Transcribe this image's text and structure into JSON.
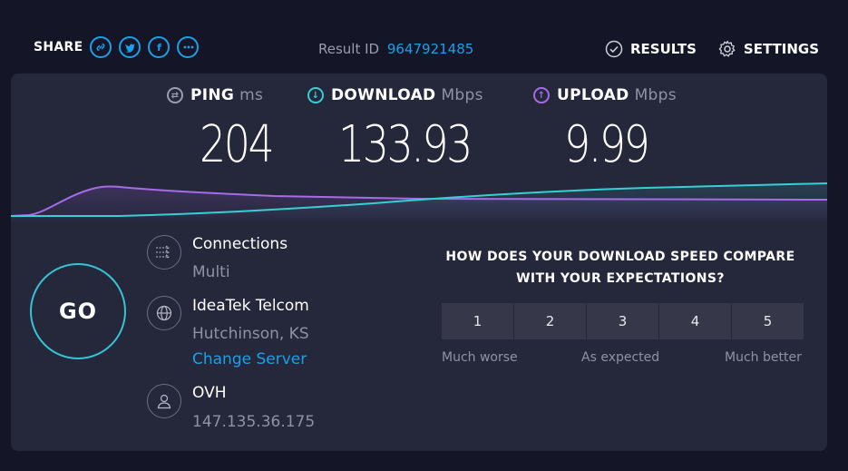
{
  "header": {
    "share_label": "SHARE",
    "share_buttons": [
      {
        "icon": "link-icon"
      },
      {
        "icon": "twitter-icon"
      },
      {
        "icon": "facebook-icon",
        "glyph": "f"
      },
      {
        "icon": "more-icon",
        "glyph": "•••"
      }
    ],
    "result_label": "Result ID",
    "result_id": "9647921485",
    "results_label": "RESULTS",
    "settings_label": "SETTINGS"
  },
  "metrics": {
    "ping": {
      "label": "PING",
      "unit": "ms",
      "value": "204"
    },
    "download": {
      "label": "DOWNLOAD",
      "unit": "Mbps",
      "value": "133.93"
    },
    "upload": {
      "label": "UPLOAD",
      "unit": "Mbps",
      "value": "9.99"
    }
  },
  "go_label": "GO",
  "connections": {
    "title": "Connections",
    "value": "Multi"
  },
  "isp": {
    "name": "IdeaTek Telcom",
    "location": "Hutchinson, KS",
    "change_link": "Change Server"
  },
  "host": {
    "name": "OVH",
    "ip": "147.135.36.175"
  },
  "survey": {
    "question": "HOW DOES YOUR DOWNLOAD SPEED COMPARE WITH YOUR EXPECTATIONS?",
    "options": [
      "1",
      "2",
      "3",
      "4",
      "5"
    ],
    "low_label": "Much worse",
    "mid_label": "As expected",
    "high_label": "Much better"
  },
  "colors": {
    "accent": "#1aa0e8",
    "download": "#35d0d6",
    "upload": "#a66be8",
    "panel": "#25273b",
    "background": "#141526"
  }
}
